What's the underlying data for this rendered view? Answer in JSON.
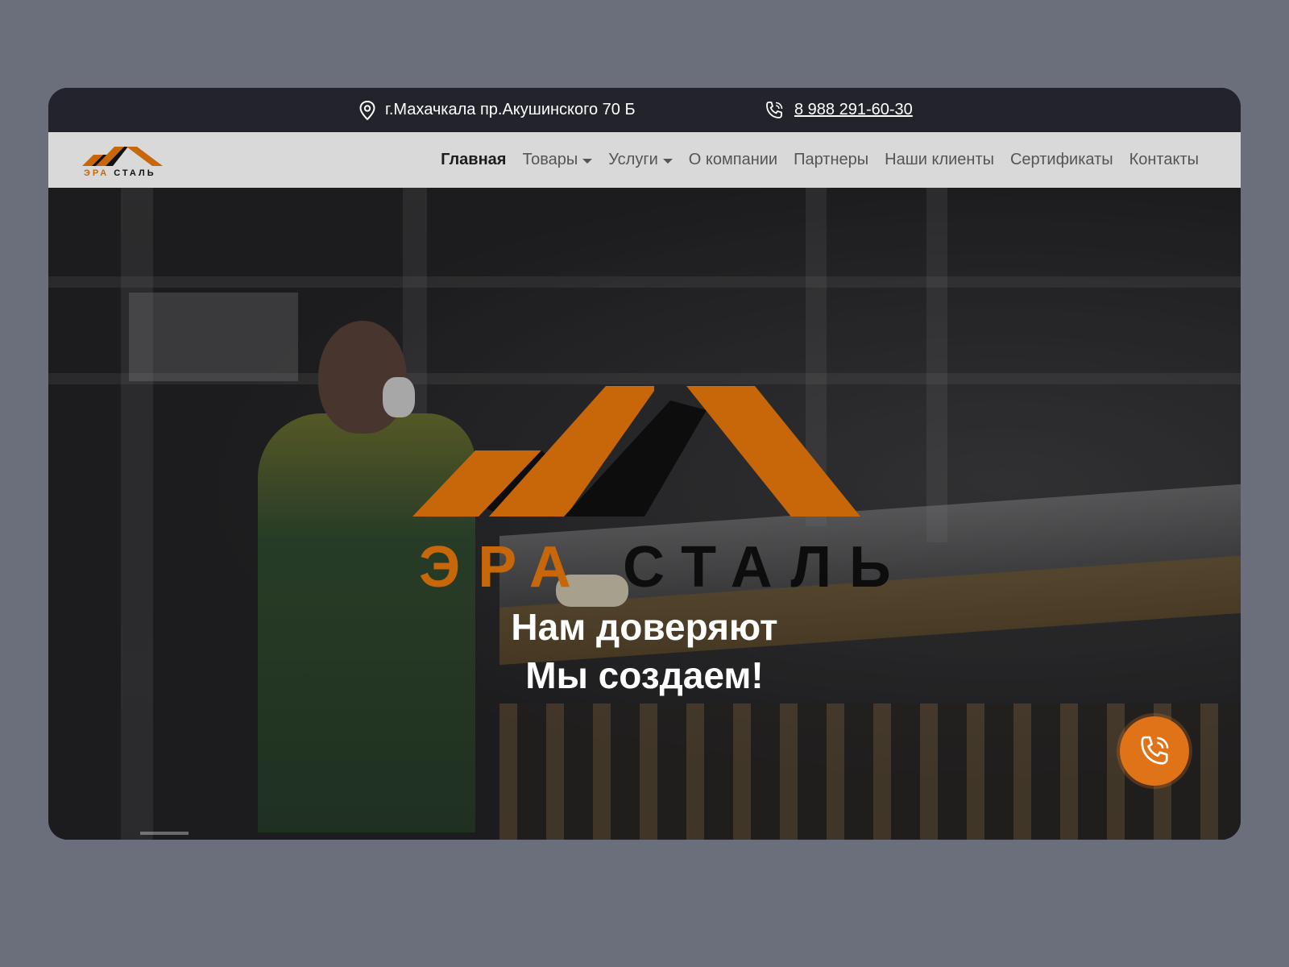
{
  "topbar": {
    "address": "г.Махачкала пр.Акушинского 70 Б",
    "phone": "8 988 291-60-30",
    "location_icon": "location-pin-icon",
    "phone_icon": "phone-ringing-icon"
  },
  "logo": {
    "word_era": "ЭРА",
    "word_stal": "СТАЛЬ"
  },
  "nav": {
    "items": [
      {
        "label": "Главная",
        "active": true
      },
      {
        "label": "Товары",
        "dropdown": true
      },
      {
        "label": "Услуги",
        "dropdown": true
      },
      {
        "label": "О компании"
      },
      {
        "label": "Партнеры"
      },
      {
        "label": "Наши клиенты"
      },
      {
        "label": "Сертификаты"
      },
      {
        "label": "Контакты"
      }
    ]
  },
  "hero": {
    "brand_era": "ЭРА",
    "brand_stal": "СТАЛЬ",
    "line1": "Нам доверяют",
    "line2": "Мы создаем!",
    "call_icon": "phone-ringing-icon"
  },
  "colors": {
    "accent": "#c8670a",
    "call_button": "#e07318",
    "topbar": "#22232b",
    "navbar": "#d9d9d9",
    "page_bg": "#6b6e7b"
  }
}
